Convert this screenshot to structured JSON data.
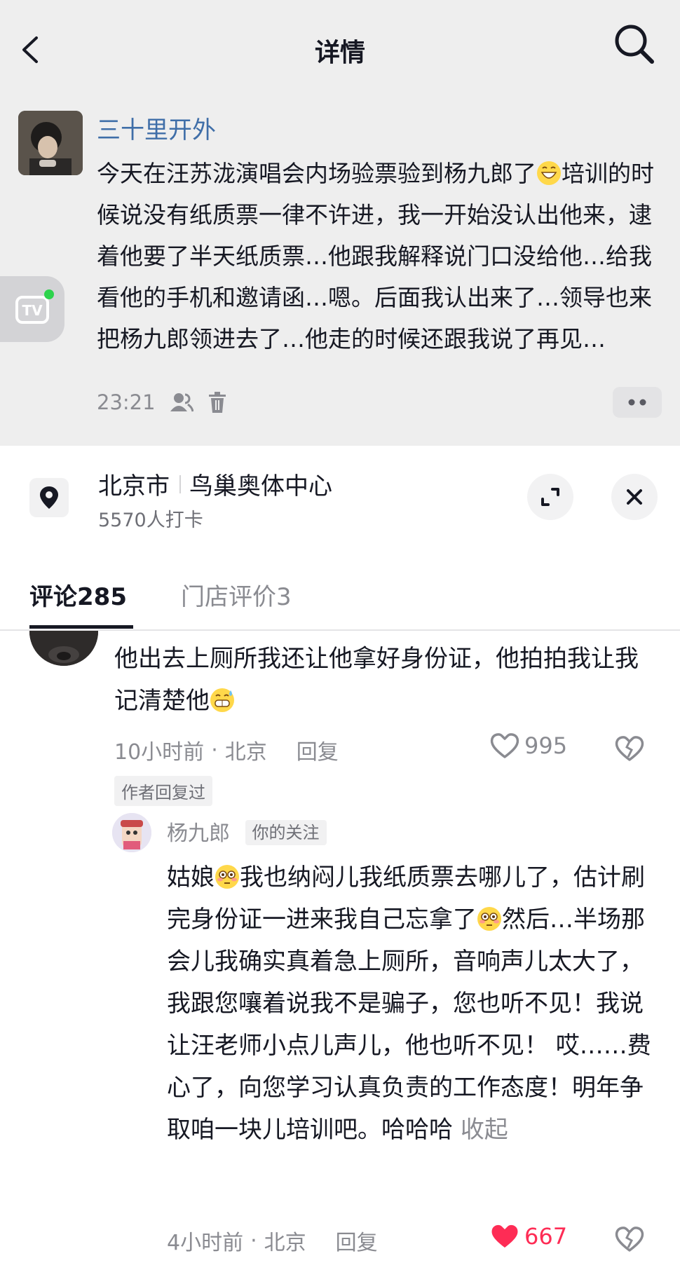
{
  "header": {
    "title": "详情"
  },
  "post": {
    "author": "三十里开外",
    "content_1": "今天在汪苏泷演唱会内场验票验到杨九郎了",
    "content_2": "培训的时候说没有纸质票一律不许进，我一开始没认出他来，逮着他要了半天纸质票…他跟我解释说门口没给他…给我看他的手机和邀请函…嗯。后面我认出来了…领导也来把杨九郎领进去了…他走的时候还跟我说了再见…",
    "time": "23:21",
    "icons": [
      "friends-visible-icon",
      "delete-icon",
      "more-icon"
    ]
  },
  "location": {
    "city": "北京市",
    "place": "鸟巢奥体中心",
    "checkins": "5570人打卡"
  },
  "tabs": {
    "comments_label": "评论",
    "comments_count": "285",
    "reviews_label": "门店评价",
    "reviews_count": "3"
  },
  "comment": {
    "text": "他出去上厕所我还让他拿好身份证，他拍拍我让我记清楚他",
    "time": "10小时前",
    "location": "北京",
    "reply": "回复",
    "likes": "995",
    "liked": false,
    "author_badge": "作者回复过"
  },
  "reply": {
    "author": "杨九郎",
    "badge": "你的关注",
    "text_1": "姑娘",
    "text_2": "我也纳闷儿我纸质票去哪儿了，估计刷完身份证一进来我自己忘拿了",
    "text_3": "然后…半场那会儿我确实真着急上厕所，音响声儿太大了，我跟您嚷着说我不是骗子，您也听不见！我说让汪老师小点儿声儿，他也听不见！ 哎……费心了，向您学习认真负责的工作态度！明年争取咱一块儿培训吧。哈哈哈",
    "collapse": "收起",
    "time": "4小时前",
    "location": "北京",
    "reply": "回复",
    "likes": "667",
    "liked": true,
    "like_color": "#fe2c55"
  },
  "separator": "·"
}
